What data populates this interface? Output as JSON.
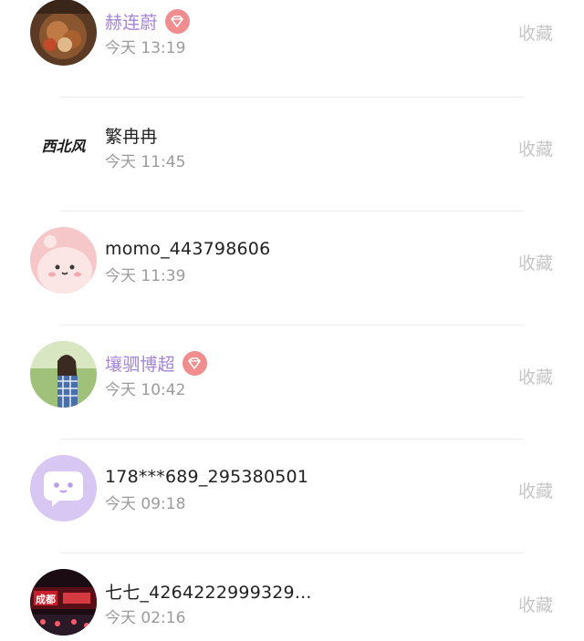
{
  "favorite_label": "收藏",
  "users": [
    {
      "name": "赫连蔚",
      "time": "今天 13:19",
      "vip": true
    },
    {
      "name": "繁冉冉",
      "time": "今天 11:45",
      "vip": false,
      "avatar_text": "西北风"
    },
    {
      "name": "momo_443798606",
      "time": "今天 11:39",
      "vip": false
    },
    {
      "name": "壤驷博超",
      "time": "今天 10:42",
      "vip": true
    },
    {
      "name": "178***689_295380501",
      "time": "今天 09:18",
      "vip": false
    },
    {
      "name": "七七_4264222999329...",
      "time": "今天 02:16",
      "vip": false,
      "avatar_text": "成都"
    }
  ],
  "colors": {
    "vip_name": "#a583d6",
    "vip_badge": "#ef8d8f",
    "name": "#222222",
    "time": "#9b9b9b",
    "favorite": "#c6c6c6"
  }
}
